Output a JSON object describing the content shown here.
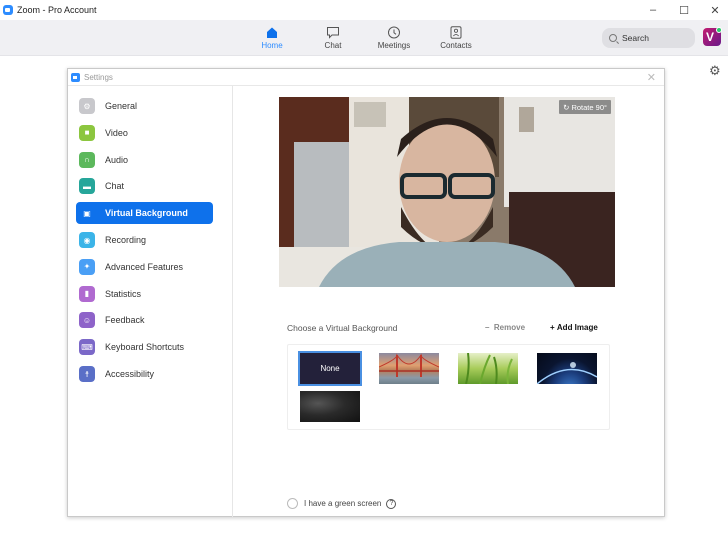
{
  "window": {
    "title": "Zoom - Pro Account",
    "minimize": "–",
    "maximize": "☐",
    "close": "✕"
  },
  "nav": {
    "items": [
      {
        "label": "Home",
        "icon": "home-icon",
        "active": true
      },
      {
        "label": "Chat",
        "icon": "chat-icon",
        "active": false
      },
      {
        "label": "Meetings",
        "icon": "clock-icon",
        "active": false
      },
      {
        "label": "Contacts",
        "icon": "contacts-icon",
        "active": false
      }
    ],
    "search_placeholder": "Search",
    "avatar_letter": "V"
  },
  "settings": {
    "title": "Settings",
    "close": "✕",
    "sidebar": [
      {
        "label": "General",
        "color": "#c8c8cc",
        "glyph": "⚙"
      },
      {
        "label": "Video",
        "color": "#8cc63f",
        "glyph": "■"
      },
      {
        "label": "Audio",
        "color": "#5cb85c",
        "glyph": "∩"
      },
      {
        "label": "Chat",
        "color": "#26a69a",
        "glyph": "▬"
      },
      {
        "label": "Virtual Background",
        "color": "#0e71eb",
        "glyph": "▣",
        "active": true
      },
      {
        "label": "Recording",
        "color": "#3bb4e8",
        "glyph": "◉"
      },
      {
        "label": "Advanced Features",
        "color": "#4a9ff5",
        "glyph": "✦"
      },
      {
        "label": "Statistics",
        "color": "#b06ad0",
        "glyph": "▮"
      },
      {
        "label": "Feedback",
        "color": "#8e63c9",
        "glyph": "☺"
      },
      {
        "label": "Keyboard Shortcuts",
        "color": "#7b68c8",
        "glyph": "⌨"
      },
      {
        "label": "Accessibility",
        "color": "#5a6fc7",
        "glyph": "☨"
      }
    ],
    "video": {
      "rotate_label": "Rotate 90°"
    },
    "choose_label": "Choose a Virtual Background",
    "remove_label": "Remove",
    "add_label": "Add Image",
    "backgrounds": [
      {
        "name": "None",
        "selected": true
      },
      {
        "name": "Golden Gate Bridge"
      },
      {
        "name": "Grass"
      },
      {
        "name": "Earth from space"
      },
      {
        "name": "Dark texture"
      }
    ],
    "green_screen_label": "I have a green screen",
    "green_screen_checked": false,
    "help_glyph": "?"
  }
}
